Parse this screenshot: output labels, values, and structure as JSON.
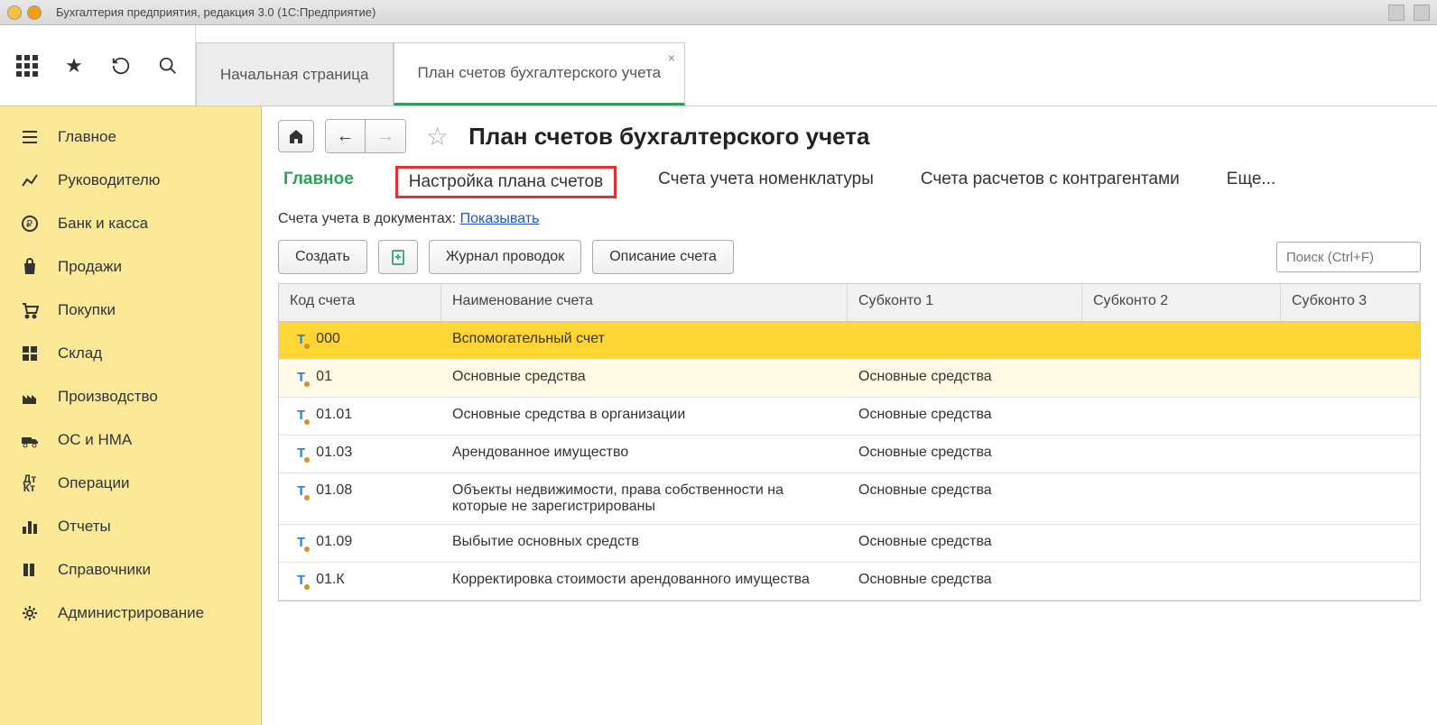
{
  "window": {
    "title": "Бухгалтерия предприятия, редакция 3.0  (1С:Предприятие)"
  },
  "tabs": [
    {
      "label": "Начальная страница",
      "active": false
    },
    {
      "label": "План счетов бухгалтерского учета",
      "active": true
    }
  ],
  "sidebar": {
    "items": [
      {
        "label": "Главное"
      },
      {
        "label": "Руководителю"
      },
      {
        "label": "Банк и касса"
      },
      {
        "label": "Продажи"
      },
      {
        "label": "Покупки"
      },
      {
        "label": "Склад"
      },
      {
        "label": "Производство"
      },
      {
        "label": "ОС и НМА"
      },
      {
        "label": "Операции"
      },
      {
        "label": "Отчеты"
      },
      {
        "label": "Справочники"
      },
      {
        "label": "Администрирование"
      }
    ]
  },
  "page": {
    "title": "План счетов бухгалтерского учета",
    "subtabs": {
      "main": "Главное",
      "settings": "Настройка плана счетов",
      "nomen": "Счета учета номенклатуры",
      "contr": "Счета расчетов с контрагентами",
      "more": "Еще..."
    },
    "docLineLabel": "Счета учета в документах: ",
    "docLineLink": "Показывать",
    "buttons": {
      "create": "Создать",
      "journal": "Журнал проводок",
      "describe": "Описание счета"
    },
    "searchPlaceholder": "Поиск (Ctrl+F)"
  },
  "table": {
    "headers": {
      "code": "Код счета",
      "name": "Наименование счета",
      "sub1": "Субконто 1",
      "sub2": "Субконто 2",
      "sub3": "Субконто 3"
    },
    "rows": [
      {
        "code": "000",
        "name": "Вспомогательный счет",
        "sub1": "",
        "selected": true
      },
      {
        "code": "01",
        "name": "Основные средства",
        "sub1": "Основные средства",
        "alt": true
      },
      {
        "code": "01.01",
        "name": "Основные средства в организации",
        "sub1": "Основные средства"
      },
      {
        "code": "01.03",
        "name": "Арендованное имущество",
        "sub1": "Основные средства"
      },
      {
        "code": "01.08",
        "name": "Объекты недвижимости, права собственности на которые не зарегистрированы",
        "sub1": "Основные средства"
      },
      {
        "code": "01.09",
        "name": "Выбытие основных средств",
        "sub1": "Основные средства"
      },
      {
        "code": "01.К",
        "name": "Корректировка стоимости арендованного имущества",
        "sub1": "Основные средства"
      }
    ]
  }
}
